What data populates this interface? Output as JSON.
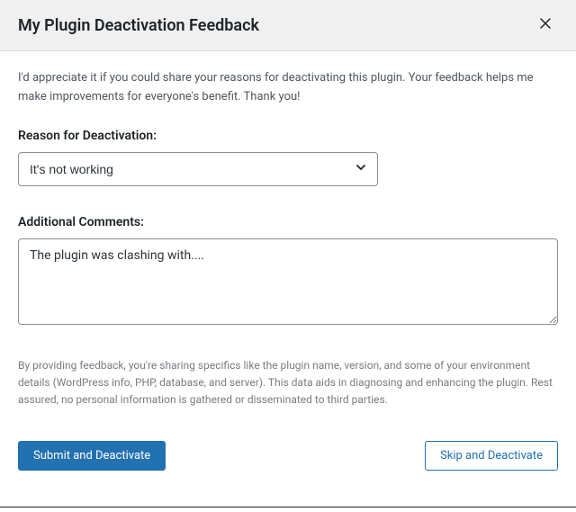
{
  "modal": {
    "title": "My Plugin Deactivation Feedback",
    "intro": "I'd appreciate it if you could share your reasons for deactivating this plugin. Your feedback helps me make improvements for everyone's benefit. Thank you!",
    "reason_label": "Reason for Deactivation:",
    "reason_selected": "It's not working",
    "comments_label": "Additional Comments:",
    "comments_value": "The plugin was clashing with....",
    "disclaimer": "By providing feedback, you're sharing specifics like the plugin name, version, and some of your environment details (WordPress info, PHP, database, and server). This data aids in diagnosing and enhancing the plugin. Rest assured, no personal information is gathered or disseminated to third parties.",
    "submit_label": "Submit and Deactivate",
    "skip_label": "Skip and Deactivate"
  }
}
